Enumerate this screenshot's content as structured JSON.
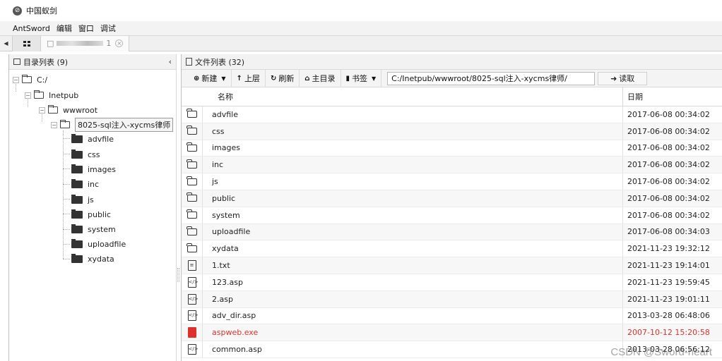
{
  "app": {
    "title": "中国蚁剑",
    "menu": [
      "AntSword",
      "编辑",
      "窗口",
      "调试"
    ]
  },
  "tabbar": {
    "shell_tab_prefix": "□",
    "shell_tab_suffix": "1"
  },
  "left_panel": {
    "title": "目录列表 (9)",
    "collapse": "‹",
    "tree": {
      "root": "C:/",
      "level1": "Inetpub",
      "level2": "wwwroot",
      "level3": "8025-sql注入-xycms律师",
      "children": [
        "advfile",
        "css",
        "images",
        "inc",
        "js",
        "public",
        "system",
        "uploadfile",
        "xydata"
      ]
    }
  },
  "right_panel": {
    "title": "文件列表 (32)",
    "toolbar": {
      "new": "新建",
      "up": "上层",
      "refresh": "刷新",
      "home": "主目录",
      "bookmark": "书签",
      "path": "C:/Inetpub/wwwroot/8025-sql注入-xycms律师/",
      "read": "读取"
    },
    "columns": {
      "name": "名称",
      "date": "日期"
    },
    "files": [
      {
        "name": "advfile",
        "date": "2017-06-08 00:34:02",
        "icon": "folder"
      },
      {
        "name": "css",
        "date": "2017-06-08 00:34:02",
        "icon": "folder"
      },
      {
        "name": "images",
        "date": "2017-06-08 00:34:02",
        "icon": "folder"
      },
      {
        "name": "inc",
        "date": "2017-06-08 00:34:02",
        "icon": "folder"
      },
      {
        "name": "js",
        "date": "2017-06-08 00:34:02",
        "icon": "folder"
      },
      {
        "name": "public",
        "date": "2017-06-08 00:34:02",
        "icon": "folder"
      },
      {
        "name": "system",
        "date": "2017-06-08 00:34:02",
        "icon": "folder"
      },
      {
        "name": "uploadfile",
        "date": "2017-06-08 00:34:03",
        "icon": "folder"
      },
      {
        "name": "xydata",
        "date": "2021-11-23 19:32:12",
        "icon": "folder"
      },
      {
        "name": "1.txt",
        "date": "2021-11-23 19:14:01",
        "icon": "text-file"
      },
      {
        "name": "123.asp",
        "date": "2021-11-23 19:59:45",
        "icon": "code-file"
      },
      {
        "name": "2.asp",
        "date": "2021-11-23 19:01:11",
        "icon": "code-file"
      },
      {
        "name": "adv_dir.asp",
        "date": "2013-03-28 06:48:06",
        "icon": "code-file"
      },
      {
        "name": "aspweb.exe",
        "date": "2007-10-12 15:20:58",
        "icon": "exe-file",
        "highlight": "#e0302c"
      },
      {
        "name": "common.asp",
        "date": "2013-03-28 06:56:12",
        "icon": "code-file"
      }
    ]
  },
  "watermark": "CSDN @Sword-heart"
}
